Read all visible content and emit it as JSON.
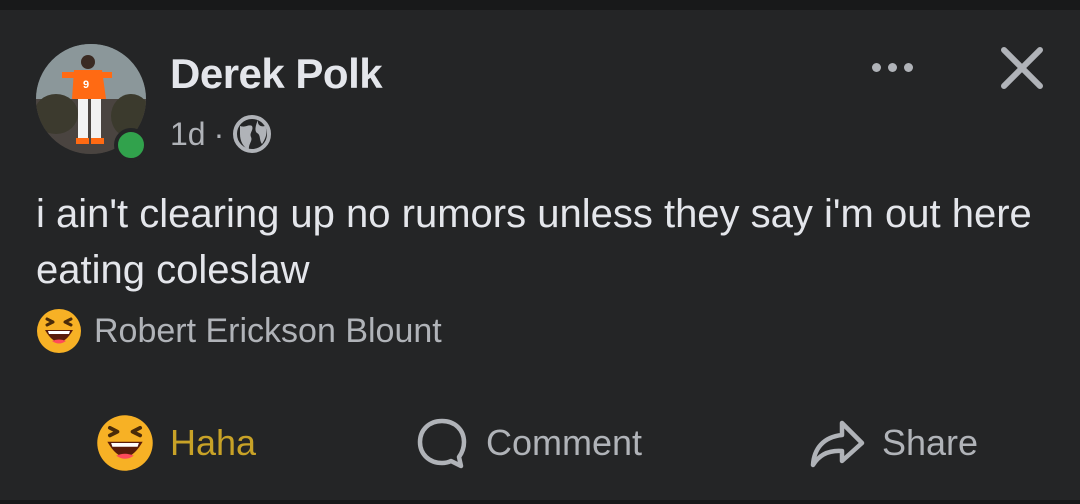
{
  "post": {
    "author": "Derek Polk",
    "time": "1d",
    "separator": "·",
    "text": "i ain't clearing up no rumors unless they say i'm out here eating coleslaw",
    "reactors": "Robert Erickson Blount"
  },
  "actions": {
    "reaction_label": "Haha",
    "comment_label": "Comment",
    "share_label": "Share"
  },
  "icons": {
    "more": "more-options-icon",
    "close": "close-icon",
    "audience": "globe-icon",
    "reaction": "haha-emoji-icon",
    "comment": "comment-icon",
    "share": "share-icon"
  },
  "colors": {
    "background": "#242526",
    "text": "#e4e6eb",
    "secondary_text": "#b0b3b8",
    "haha_accent": "#c8a227",
    "online": "#31a24c"
  }
}
